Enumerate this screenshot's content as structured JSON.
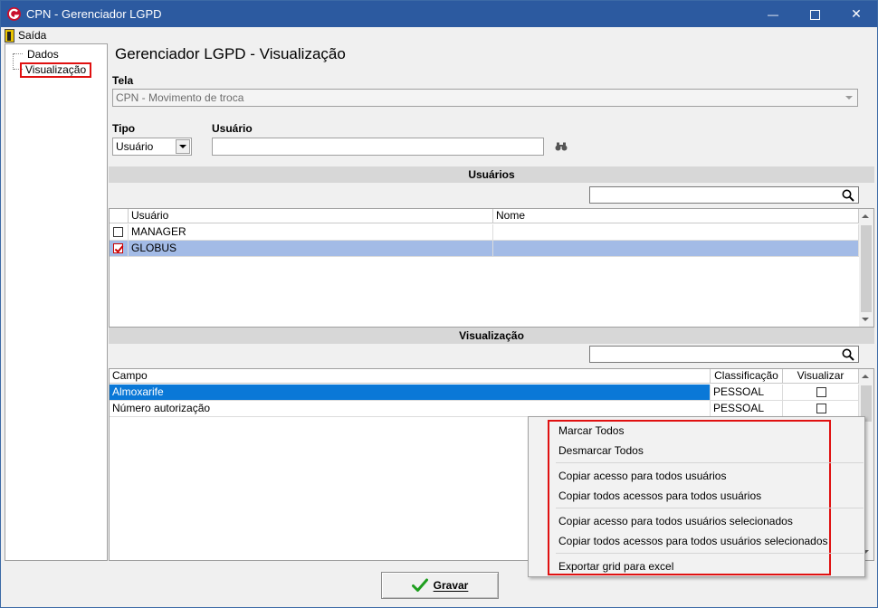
{
  "window": {
    "title": "CPN - Gerenciador LGPD",
    "minimize": "—",
    "close": "✕"
  },
  "menu": {
    "exit_label": "Saída"
  },
  "tree": {
    "items": [
      "Dados",
      "Visualização"
    ]
  },
  "page": {
    "heading": "Gerenciador LGPD - Visualização"
  },
  "tela": {
    "label": "Tela",
    "value": "CPN - Movimento de troca"
  },
  "tipo": {
    "label": "Tipo",
    "value": "Usuário"
  },
  "usuario": {
    "label": "Usuário",
    "value": ""
  },
  "users_section": {
    "title": "Usuários",
    "search_value": "",
    "columns": [
      "Usuário",
      "Nome"
    ],
    "rows": [
      {
        "usuario": "MANAGER",
        "nome": "",
        "checked": false,
        "selected": false
      },
      {
        "usuario": "GLOBUS",
        "nome": "",
        "checked": true,
        "selected": true
      }
    ]
  },
  "view_section": {
    "title": "Visualização",
    "search_value": "",
    "columns": [
      "Campo",
      "Classificação",
      "Visualizar"
    ],
    "rows": [
      {
        "campo": "Almoxarife",
        "classificacao": "PESSOAL",
        "visualizar": false,
        "selected": true
      },
      {
        "campo": "Número autorização",
        "classificacao": "PESSOAL",
        "visualizar": false,
        "selected": false
      }
    ]
  },
  "context_menu": {
    "items": [
      "Marcar Todos",
      "Desmarcar Todos",
      "Copiar acesso para todos usuários",
      "Copiar todos acessos para todos usuários",
      "Copiar acesso para todos usuários selecionados",
      "Copiar todos acessos para todos usuários selecionados",
      "Exportar grid para excel"
    ]
  },
  "footer": {
    "save_label": "Gravar"
  },
  "colors": {
    "titlebar": "#2c5aa0",
    "selected_row": "#a3bbe6",
    "active_row": "#0a78d7",
    "highlight_border": "#e01010"
  }
}
